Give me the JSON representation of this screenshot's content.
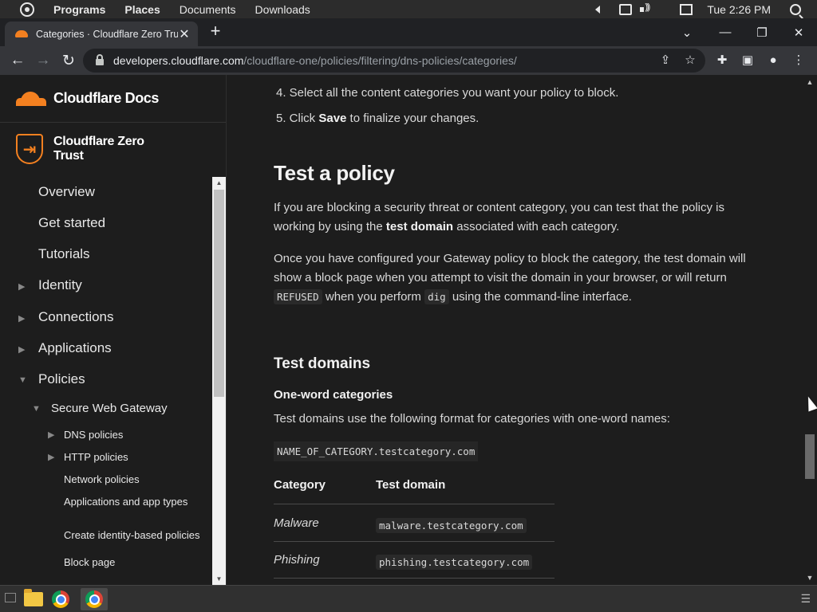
{
  "os_bar": {
    "menus": [
      "Programs",
      "Places",
      "Documents",
      "Downloads"
    ],
    "clock": "Tue 2:26 PM"
  },
  "browser": {
    "tab_title": "Categories · Cloudflare Zero Trust",
    "url_host": "developers.cloudflare.com",
    "url_path": "/cloudflare-one/policies/filtering/dns-policies/categories/"
  },
  "sidebar": {
    "brand": "Cloudflare Docs",
    "product": "Cloudflare Zero Trust",
    "items": [
      {
        "label": "Overview",
        "level": 0,
        "caret": ""
      },
      {
        "label": "Get started",
        "level": 0,
        "caret": ""
      },
      {
        "label": "Tutorials",
        "level": 0,
        "caret": ""
      },
      {
        "label": "Identity",
        "level": 0,
        "caret": "collapsed"
      },
      {
        "label": "Connections",
        "level": 0,
        "caret": "collapsed"
      },
      {
        "label": "Applications",
        "level": 0,
        "caret": "collapsed"
      },
      {
        "label": "Policies",
        "level": 0,
        "caret": "expanded"
      },
      {
        "label": "Secure Web Gateway",
        "level": 1,
        "caret": "expanded"
      },
      {
        "label": "DNS policies",
        "level": 2,
        "caret": "collapsed"
      },
      {
        "label": "HTTP policies",
        "level": 2,
        "caret": "collapsed"
      },
      {
        "label": "Network policies",
        "level": 2,
        "caret": ""
      },
      {
        "label": "Applications and app types",
        "level": 2,
        "caret": ""
      },
      {
        "label": "Create identity-based policies",
        "level": 2,
        "caret": ""
      },
      {
        "label": "Block page",
        "level": 2,
        "caret": ""
      }
    ]
  },
  "content": {
    "step4": "4. Select all the content categories you want your policy to block.",
    "step5_pre": "5. Click ",
    "step5_bold": "Save",
    "step5_post": " to finalize your changes.",
    "heading": "Test a policy",
    "p1_pre": "If you are blocking a security threat or content category, you can test that the policy is working by using the ",
    "p1_bold": "test domain",
    "p1_post": " associated with each category.",
    "p2_a": "Once you have configured your Gateway policy to block the category, the test domain will show a block page when you attempt to visit the domain in your browser, or will return ",
    "p2_code1": "REFUSED",
    "p2_b": " when you perform ",
    "p2_code2": "dig",
    "p2_c": " using the command-line interface.",
    "subheading": "Test domains",
    "subsubheading": "One-word categories",
    "p3": "Test domains use the following format for categories with one-word names:",
    "format_code": "NAME_OF_CATEGORY.testcategory.com",
    "table": {
      "headers": [
        "Category",
        "Test domain"
      ],
      "rows": [
        {
          "category": "Malware",
          "domain": "malware.testcategory.com"
        },
        {
          "category": "Phishing",
          "domain": "phishing.testcategory.com"
        }
      ]
    }
  }
}
